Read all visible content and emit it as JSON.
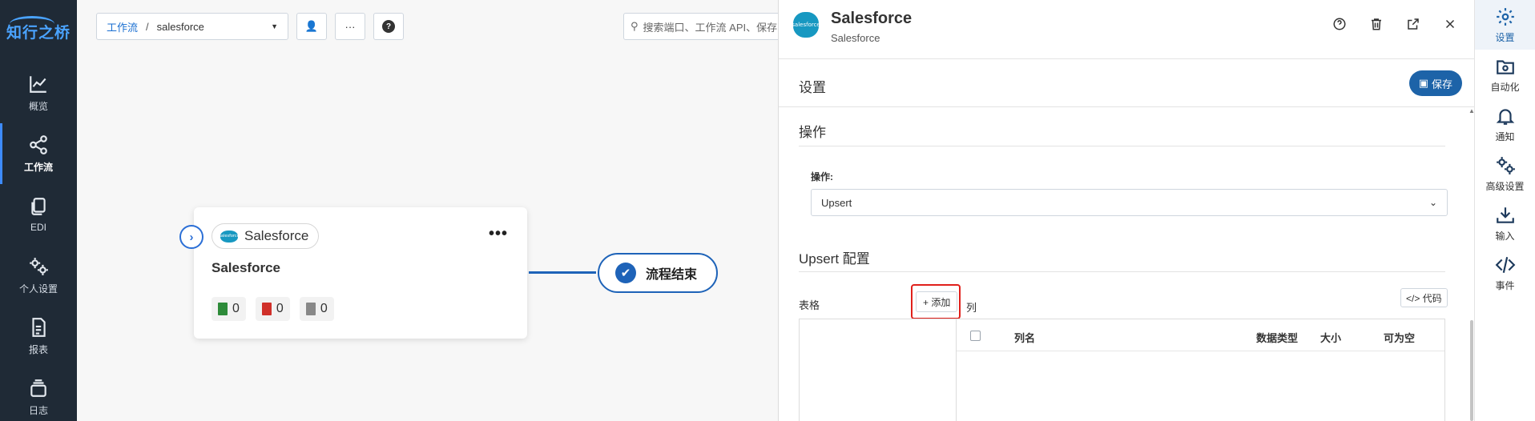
{
  "app": {
    "logo_text": "知行之桥"
  },
  "leftnav": {
    "items": [
      {
        "label": "概览",
        "icon": "chart-line-icon"
      },
      {
        "label": "工作流",
        "icon": "share-nodes-icon"
      },
      {
        "label": "EDI",
        "icon": "documents-icon"
      },
      {
        "label": "个人设置",
        "icon": "gears-icon"
      },
      {
        "label": "报表",
        "icon": "report-icon"
      },
      {
        "label": "日志",
        "icon": "log-stack-icon"
      }
    ],
    "active_index": 1
  },
  "canvas": {
    "breadcrumb": {
      "root": "工作流",
      "separator": "/",
      "current": "salesforce"
    },
    "toolbar": {
      "user_icon": "👤",
      "more_icon": "···",
      "help_icon": "?"
    },
    "search": {
      "placeholder": "搜索端口、工作流 API、保存"
    },
    "node": {
      "chip_label": "Salesforce",
      "sf_logo_text": "salesforce",
      "title": "Salesforce",
      "more": "•••",
      "expand_icon": "›",
      "stats": [
        {
          "type": "success",
          "count": "0",
          "color": "#2e8b3a"
        },
        {
          "type": "error",
          "count": "0",
          "color": "#d0302a"
        },
        {
          "type": "pending",
          "count": "0",
          "color": "#888888"
        }
      ]
    },
    "end_node": {
      "label": "流程结束",
      "check": "✔"
    }
  },
  "panel": {
    "title": "Salesforce",
    "subtitle": "Salesforce",
    "logo_text": "salesforce",
    "settings_label": "设置",
    "save_label": "保存",
    "operation_section": "操作",
    "operation_label": "操作:",
    "operation_value": "Upsert",
    "upsert_section": "Upsert 配置",
    "table_label": "表格",
    "add_label": "+ 添加",
    "column_label": "列",
    "code_label": "</> 代码",
    "columns": [
      "列名",
      "数据类型",
      "大小",
      "可为空"
    ]
  },
  "rnav": {
    "items": [
      {
        "label": "设置",
        "icon": "gear-icon"
      },
      {
        "label": "自动化",
        "icon": "folder-gear-icon"
      },
      {
        "label": "通知",
        "icon": "bell-icon"
      },
      {
        "label": "高级设置",
        "icon": "gears-icon"
      },
      {
        "label": "输入",
        "icon": "inbox-download-icon"
      },
      {
        "label": "事件",
        "icon": "code-icon"
      }
    ],
    "active_index": 0
  },
  "colors": {
    "accent": "#1d63a8",
    "nav_bg": "#1f2a36",
    "highlight": "#e0201b"
  }
}
